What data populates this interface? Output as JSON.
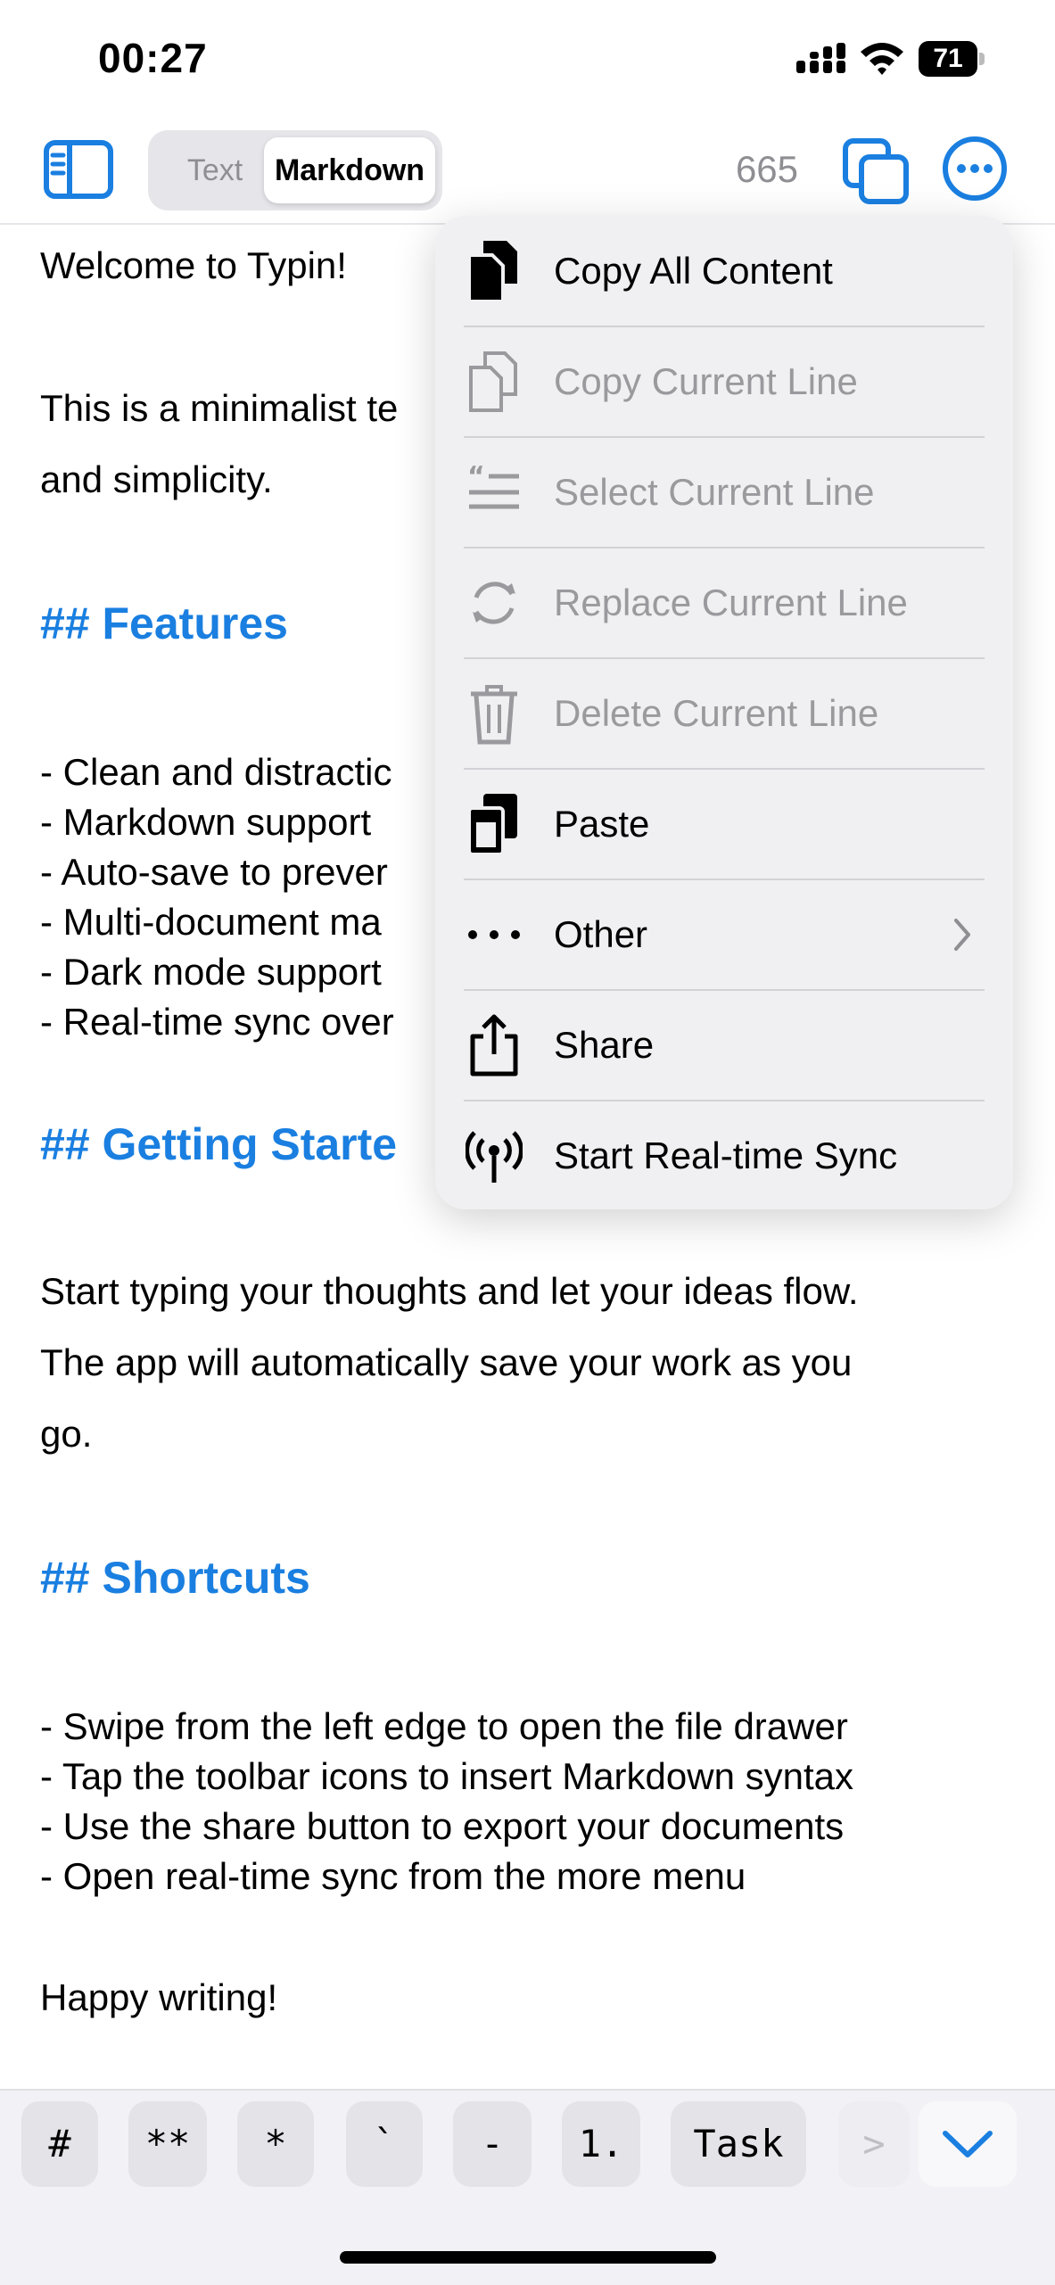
{
  "status": {
    "time": "00:27",
    "battery": "71"
  },
  "toolbar": {
    "modes": [
      "Text",
      "Markdown"
    ],
    "selected_mode": "Markdown",
    "char_count": "665",
    "sidebar_icon": "sidebar-icon",
    "copy_icon": "copy-icon",
    "more_icon": "ellipsis-circle-icon"
  },
  "editor": {
    "lines": [
      {
        "text": "Welcome to Typin!",
        "kind": "text"
      },
      {
        "text": "This is a minimalist te",
        "kind": "text"
      },
      {
        "text": "and simplicity.",
        "kind": "text"
      },
      {
        "text": "## Features",
        "kind": "heading"
      },
      {
        "text": "- Clean and distractic",
        "kind": "text"
      },
      {
        "text": "- Markdown support",
        "kind": "text"
      },
      {
        "text": "- Auto-save to prever",
        "kind": "text"
      },
      {
        "text": "- Multi-document ma",
        "kind": "text"
      },
      {
        "text": "- Dark mode support",
        "kind": "text"
      },
      {
        "text": "- Real-time sync over",
        "kind": "text"
      },
      {
        "text": "## Getting Starte",
        "kind": "heading"
      },
      {
        "text": "Start typing your thoughts and let your ideas flow.",
        "kind": "text"
      },
      {
        "text": "The app will automatically save your work as you",
        "kind": "text"
      },
      {
        "text": "go.",
        "kind": "text"
      },
      {
        "text": "## Shortcuts",
        "kind": "heading"
      },
      {
        "text": "- Swipe from the left edge to open the file drawer",
        "kind": "text"
      },
      {
        "text": "- Tap the toolbar icons to insert Markdown syntax",
        "kind": "text"
      },
      {
        "text": "- Use the share button to export your documents",
        "kind": "text"
      },
      {
        "text": "- Open real-time sync from the more menu",
        "kind": "text"
      },
      {
        "text": "Happy writing!",
        "kind": "text"
      }
    ]
  },
  "menu": {
    "items": [
      {
        "label": "Copy All Content",
        "icon": "copy-all-icon",
        "enabled": true
      },
      {
        "label": "Copy Current Line",
        "icon": "copy-line-icon",
        "enabled": false
      },
      {
        "label": "Select Current Line",
        "icon": "select-line-icon",
        "enabled": false
      },
      {
        "label": "Replace Current Line",
        "icon": "replace-icon",
        "enabled": false
      },
      {
        "label": "Delete Current Line",
        "icon": "trash-icon",
        "enabled": false
      },
      {
        "label": "Paste",
        "icon": "paste-icon",
        "enabled": true
      },
      {
        "label": "Other",
        "icon": "ellipsis-icon",
        "enabled": true,
        "submenu": true
      },
      {
        "label": "Share",
        "icon": "share-icon",
        "enabled": true
      },
      {
        "label": "Start Real-time Sync",
        "icon": "antenna-icon",
        "enabled": true
      }
    ]
  },
  "keyboard_bar": {
    "keys": [
      "#",
      "**",
      "*",
      "`",
      "-",
      "1.",
      "Task",
      ">"
    ],
    "dismiss_icon": "chevron-down-icon"
  },
  "colors": {
    "accent": "#1a7fe0",
    "heading": "#1a7fe0",
    "disabled": "#9a9a9e"
  }
}
